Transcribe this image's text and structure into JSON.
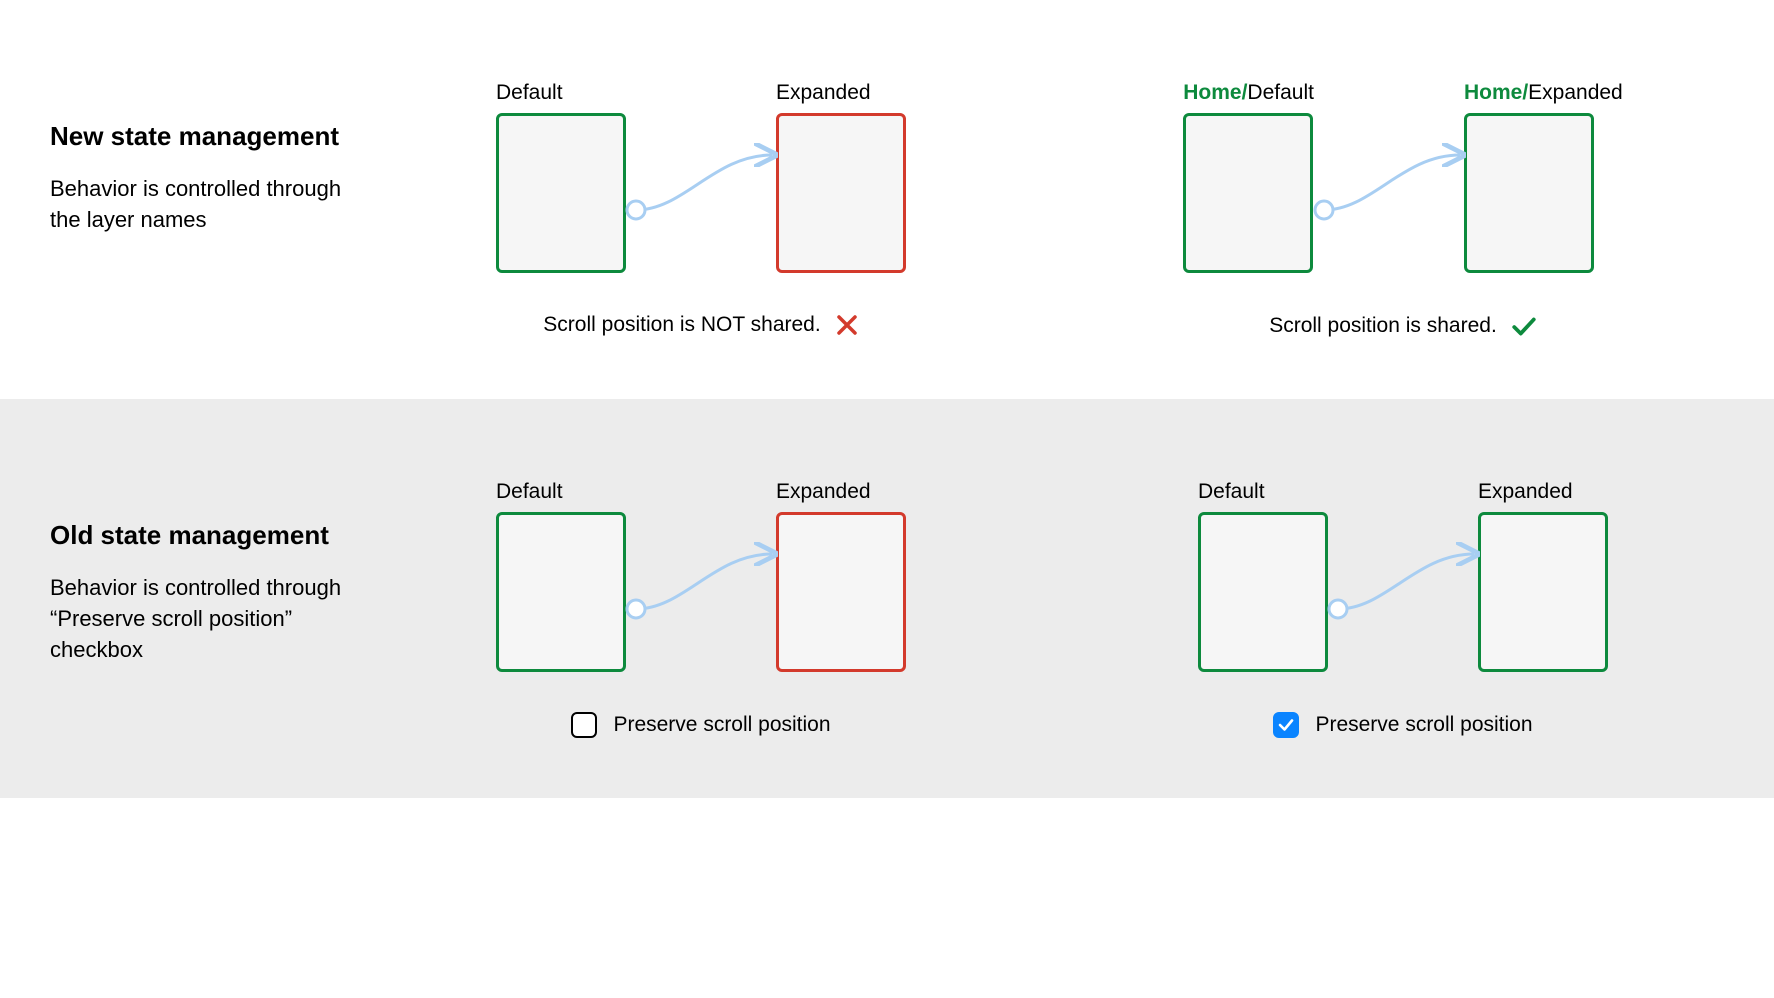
{
  "rows": {
    "new": {
      "title": "New state management",
      "desc": "Behavior is controlled through the layer names"
    },
    "old": {
      "title": "Old state management",
      "desc": "Behavior is controlled through “Preserve scroll position” checkbox"
    }
  },
  "labels": {
    "default": "Default",
    "expanded": "Expanded",
    "prefix": "Home/"
  },
  "captions": {
    "notShared": "Scroll position is NOT shared.",
    "shared": "Scroll position is shared."
  },
  "checkbox": {
    "label": "Preserve scroll position"
  },
  "colors": {
    "green": "#0d8a3d",
    "red": "#d33a2c",
    "link": "#a8cef2",
    "checkboxBlue": "#0a84ff"
  }
}
